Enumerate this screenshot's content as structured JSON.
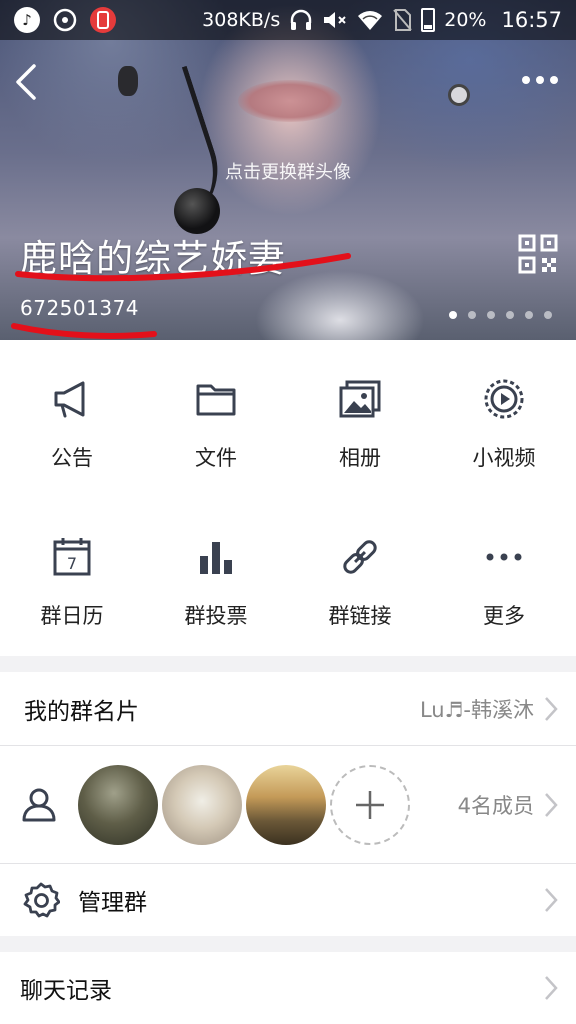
{
  "status_bar": {
    "network_speed": "308KB/s",
    "battery": "20%",
    "time": "16:57",
    "icons": [
      "music-app-icon",
      "player-app-icon",
      "notification-app-icon",
      "headphones-icon",
      "mute-icon",
      "wifi-icon",
      "no-sim-icon",
      "battery-icon"
    ]
  },
  "header": {
    "change_avatar_hint": "点击更换群头像",
    "group_name": "鹿晗的综艺娇妻",
    "group_id": "672501374",
    "page_indicator": {
      "count": 6,
      "active": 1
    }
  },
  "features": {
    "row1": [
      {
        "label": "公告",
        "icon": "megaphone-icon"
      },
      {
        "label": "文件",
        "icon": "folder-icon"
      },
      {
        "label": "相册",
        "icon": "album-icon"
      },
      {
        "label": "小视频",
        "icon": "video-icon"
      }
    ],
    "row2": [
      {
        "label": "群日历",
        "icon": "calendar-icon",
        "calendar_day": "7"
      },
      {
        "label": "群投票",
        "icon": "bar-chart-icon"
      },
      {
        "label": "群链接",
        "icon": "link-icon"
      },
      {
        "label": "更多",
        "icon": "more-dots-icon"
      }
    ]
  },
  "group_card": {
    "title": "我的群名片",
    "value": "Lu♬-韩溪沐"
  },
  "members": {
    "count_text": "4名成员"
  },
  "manage": {
    "title": "管理群"
  },
  "chat_history": {
    "title": "聊天记录"
  },
  "colors": {
    "icon_gray": "#3a4150",
    "annotation_red": "#e3101a",
    "accent_blue": "#1f9ef0"
  }
}
